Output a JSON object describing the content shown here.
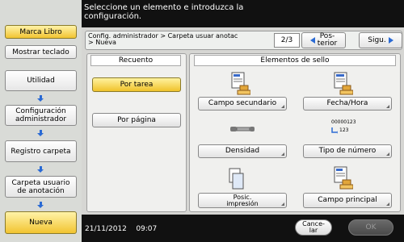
{
  "header": {
    "instruction_line1": "Seleccione un elemento e introduzca la",
    "instruction_line2": "configuración."
  },
  "sidebar": {
    "marca_libro": "Marca Libro",
    "mostrar_teclado": "Mostrar teclado",
    "steps": [
      {
        "label": "Utilidad"
      },
      {
        "label_line1": "Configuración",
        "label_line2": "administrador"
      },
      {
        "label": "Registro carpeta"
      },
      {
        "label_line1": "Carpeta usuario",
        "label_line2": "de anotación"
      },
      {
        "label": "Nueva"
      }
    ]
  },
  "breadcrumb": {
    "line1": "Config. administrador > Carpeta usuar anotac",
    "line2": "> Nueva"
  },
  "pagination": {
    "page": "2/3",
    "prev_line1": "Pos-",
    "prev_line2": "terior",
    "next": "Sigu."
  },
  "recuento": {
    "title": "Recuento",
    "options": [
      "Por tarea",
      "Por página"
    ],
    "selected": "Por tarea"
  },
  "stamp_elements": {
    "title": "Elementos de sello",
    "items": [
      {
        "label": "Campo secundario",
        "icon": "document-stamp-icon"
      },
      {
        "label": "Fecha/Hora",
        "icon": "document-datetime-icon"
      },
      {
        "label": "Densidad",
        "icon": "density-icon"
      },
      {
        "label": "Tipo de número",
        "icon": "number-type-icon",
        "icon_text1": "00000123",
        "icon_text2": "123"
      },
      {
        "label_line1": "Posic.",
        "label_line2": "impresión",
        "icon": "print-position-icon"
      },
      {
        "label": "Campo principal",
        "icon": "document-stamp-icon"
      }
    ]
  },
  "footer": {
    "datetime": "21/11/2012    09:07",
    "cancel_line1": "Cance-",
    "cancel_line2": "lar",
    "ok": "OK"
  },
  "colors": {
    "accent_yellow": "#f2c431",
    "arrow_blue": "#2a6ad4"
  }
}
